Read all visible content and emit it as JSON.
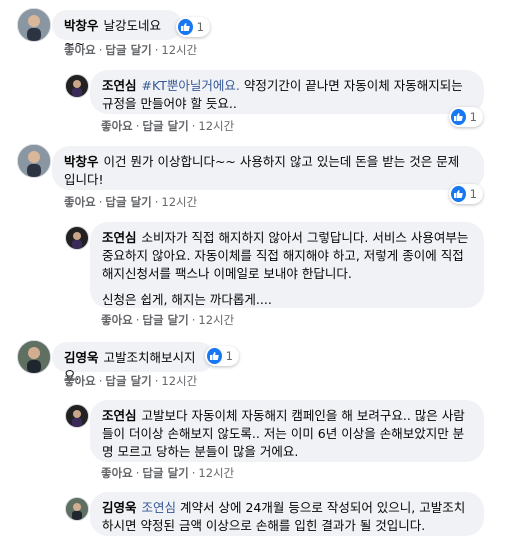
{
  "comments": [
    {
      "author": "박창우",
      "tag": "",
      "text": "날강도네요~~",
      "like_label": "좋아요",
      "reply_label": "답글 달기",
      "time": "12시간",
      "reactions": "1"
    },
    {
      "author": "조연심",
      "tag": "#KT뿐아닐거에요.",
      "text": "약정기간이 끝나면 자동이체 자동해지되는 규정을 만들어야 할 듯요..",
      "like_label": "좋아요",
      "reply_label": "답글 달기",
      "time": "12시간",
      "reactions": "1"
    },
    {
      "author": "박창우",
      "tag": "",
      "text": "이건 뭔가 이상합니다~~ 사용하지 않고 있는데 돈을 받는 것은 문제 입니다!",
      "like_label": "좋아요",
      "reply_label": "답글 달기",
      "time": "12시간",
      "reactions": "1"
    },
    {
      "author": "조연심",
      "tag": "",
      "text": "소비자가 직접 해지하지 않아서 그렇답니다. 서비스 사용여부는 중요하지 않아요. 자동이체를 직접 해지해야 하고, 저렇게 종이에 직접 해지신청서를 팩스나 이메일로 보내야 한답니다.",
      "text2": "신청은 쉽게, 해지는 까다롭게....",
      "like_label": "좋아요",
      "reply_label": "답글 달기",
      "time": "12시간",
      "reactions": ""
    },
    {
      "author": "김영욱",
      "tag": "",
      "text": "고발조치해보시지요.",
      "like_label": "좋아요",
      "reply_label": "답글 달기",
      "time": "12시간",
      "reactions": "1"
    },
    {
      "author": "조연심",
      "tag": "",
      "text": "고발보다 자동이체 자동해지 캠페인을 해 보려구요.. 많은 사람들이 더이상 손해보지 않도록.. 저는 이미 6년 이상을 손해보았지만 분명 모르고 당하는 분들이 많을 거에요.",
      "like_label": "좋아요",
      "reply_label": "답글 달기",
      "time": "12시간",
      "reactions": ""
    },
    {
      "author": "김영욱",
      "tag": "조연심",
      "text": "계약서 상에 24개월 등으로 작성되어 있으니, 고발조치하시면 약정된 금액 이상으로 손해를 입힌 결과가 될 것입니다.",
      "like_label": "",
      "reply_label": "",
      "time": "",
      "reactions": ""
    }
  ]
}
